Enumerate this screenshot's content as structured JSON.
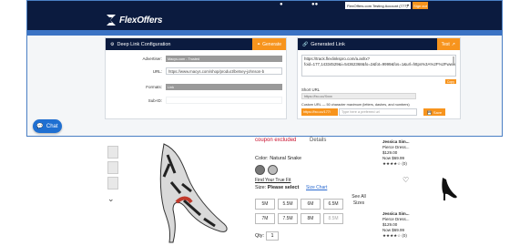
{
  "background_page": {
    "coupon_text": "coupon excluded",
    "coupon_details": "Details",
    "color_label": "Color:",
    "color_value": "Natural Snake",
    "find_fit": "Find Your True Fit",
    "size_label": "Size:",
    "size_value": "Please select",
    "size_chart": "Size Chart",
    "sizes": [
      "5M",
      "5.5M",
      "6M",
      "6.5M",
      "7M",
      "7.5M",
      "8M",
      "8.5M"
    ],
    "see_all_sizes": "See All Sizes",
    "qty_label": "Qty:",
    "qty_value": "1",
    "related_products": [
      {
        "name": "Jessica Sim...",
        "subtitle": "Pierce Dress...",
        "price_old": "$129.00",
        "price_sale": "Now $69.99",
        "stars": "★★★★☆ (0)"
      },
      {
        "name": "Jessica Sim...",
        "subtitle": "Pierce Dress...",
        "price_old": "$129.00",
        "price_sale": "Now $69.99",
        "stars": "★★★★☆ (0)"
      }
    ]
  },
  "topbar": {
    "account_label": "FlexOffers.com Testing Account (777)",
    "sign_out": "Sign out"
  },
  "header": {
    "logo_text": "FlexOffers"
  },
  "deep_link_panel": {
    "title": "Deep Link Configuration",
    "generate_button": "Generate",
    "advertiser_label": "Advertiser:",
    "advertiser_value": "Macys.com - Trusted",
    "url_label": "URL:",
    "url_value": "https://www.macys.com/shop/product/betsey-johnson-b",
    "formats_label": "Formats:",
    "formats_value": "Link",
    "subid_label": "Sub-ID:",
    "subid_value": ""
  },
  "generated_link_panel": {
    "title": "Generated Link",
    "test_button": "Test",
    "link_value": "https://track.flexlinkspro.com/a.ashx?foid=177,14334529&i=54362368&fo=2&fot=9999&fos=1&url=https%3A%2F%2Fwww.macys.com%2Fshop%2Fproduct%2Fbetsey-",
    "copy_button": "Copy",
    "short_url_label": "Short URL",
    "short_url_value": "https://fxo.co/Xxxx",
    "custom_url_label": "Custom URL — 50 character maximum (letters, dashes, and numbers)",
    "custom_prefix": "https://fxo.co/177/",
    "custom_placeholder": "Type here a preferred url",
    "save_button": "Save"
  },
  "chat": {
    "label": "Chat"
  },
  "colors": {
    "navy": "#0b1b3f",
    "accent_orange": "#f7941d",
    "accent_blue": "#3b73c4",
    "chat_blue": "#1f6fd1"
  },
  "icons": [
    "user-icon",
    "users-icon",
    "gear-icon",
    "link-icon",
    "external-link-icon",
    "save-icon",
    "chat-icon",
    "heart-icon"
  ]
}
